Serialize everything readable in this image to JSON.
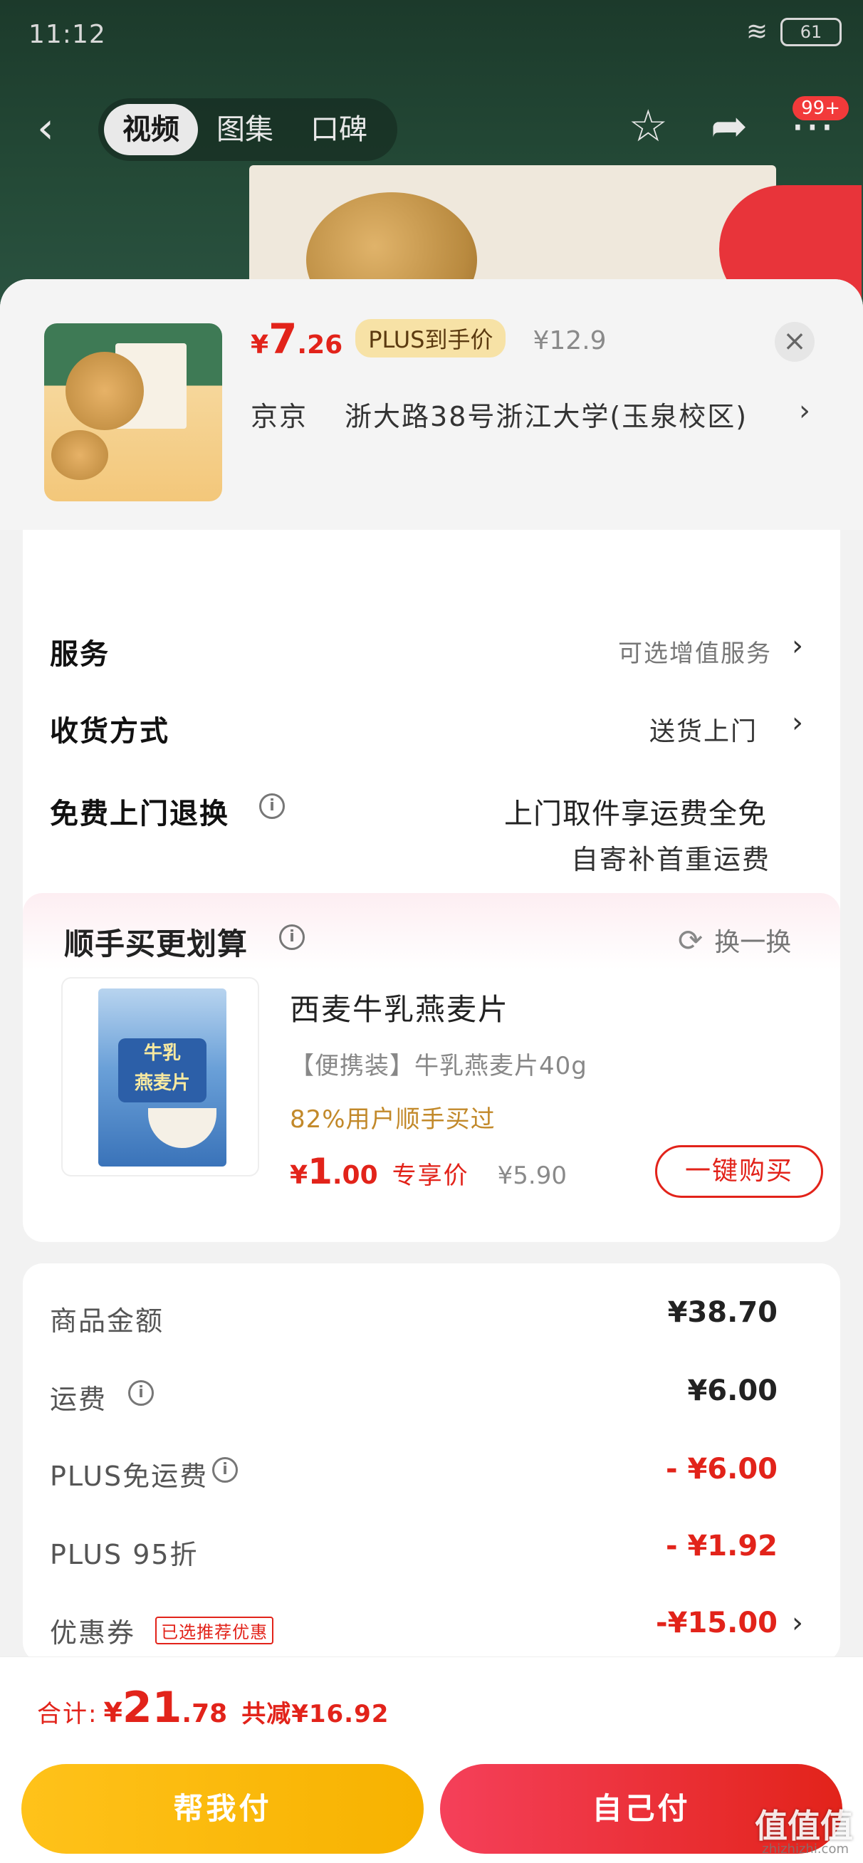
{
  "status_bar": {
    "time": "11:12",
    "battery": "61"
  },
  "header": {
    "tabs": [
      "视频",
      "图集",
      "口碑"
    ],
    "active_tab": 0,
    "cart_badge": "99+"
  },
  "product": {
    "price_yen": "¥",
    "price_int": "7",
    "price_dec": ".26",
    "plus_tag": "PLUS到手价",
    "original_price": "¥12.9",
    "close_icon": "×",
    "address_city": "京京",
    "address_detail": "浙大路38号浙江大学(玉泉校区)"
  },
  "options": {
    "service_label": "服务",
    "service_value": "可选增值服务",
    "delivery_label": "收货方式",
    "delivery_value": "送货上门",
    "return_label": "免费上门退换",
    "return_value_1": "上门取件享运费全免",
    "return_value_2": "自寄补首重运费"
  },
  "upsell": {
    "title": "顺手买更划算",
    "refresh_label": "换一换",
    "product_name": "西麦牛乳燕麦片",
    "product_spec": "【便携装】牛乳燕麦片40g",
    "product_stat": "82%用户顺手买过",
    "price_yen": "¥",
    "price_int": "1",
    "price_dec": ".00",
    "price_tag": "专享价",
    "old_price": "¥5.90",
    "buy_label": "一键购买",
    "pack_text": "牛乳\n燕麦片"
  },
  "summary": {
    "rows": [
      {
        "label": "商品金额",
        "value": "¥38.70"
      },
      {
        "label": "运费",
        "value": "¥6.00"
      },
      {
        "label": "PLUS免运费",
        "value": "- ¥6.00"
      },
      {
        "label": "PLUS 95折",
        "value": "- ¥1.92"
      },
      {
        "label": "优惠券",
        "value": "-¥15.00"
      }
    ],
    "coupon_tag": "已选推荐优惠"
  },
  "bottom": {
    "total_label": "合计:",
    "total_yen": "¥",
    "total_int": "21",
    "total_dec": ".78",
    "reduce_text": "共减¥16.92",
    "help_pay": "帮我付",
    "self_pay": "自己付"
  },
  "watermark": {
    "main": "值值值",
    "sub": "zhizhizhi.com"
  },
  "colors": {
    "accent_red": "#e2231a",
    "plus_gold": "#f7e2a6",
    "help_yellow": "#ffc21a"
  }
}
